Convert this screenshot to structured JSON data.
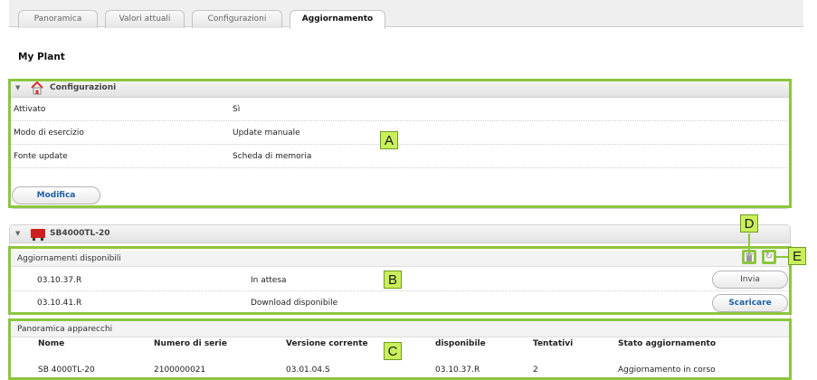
{
  "tabs": [
    {
      "label": "Panoramica",
      "active": false
    },
    {
      "label": "Valori attuali",
      "active": false
    },
    {
      "label": "Configurazioni",
      "active": false
    },
    {
      "label": "Aggiornamento",
      "active": true
    }
  ],
  "plant_title": "My Plant",
  "config_panel": {
    "title": "Configurazioni",
    "rows": [
      {
        "label": "Attivato",
        "value": "Sì"
      },
      {
        "label": "Modo di esercizio",
        "value": "Update manuale"
      },
      {
        "label": "Fonte update",
        "value": "Scheda di memoria"
      }
    ],
    "edit_button": "Modifica"
  },
  "device_panel": {
    "title": "SB4000TL-20",
    "updates_header": "Aggiornamenti disponibili",
    "updates": [
      {
        "version": "03.10.37.R",
        "status": "In attesa",
        "action": "Invia"
      },
      {
        "version": "03.10.41.R",
        "status": "Download disponibile",
        "action": "Scaricare"
      }
    ],
    "overview_header": "Panoramica apparecchi",
    "table": {
      "headers": [
        "Nome",
        "Numero di serie",
        "Versione corrente",
        "disponibile",
        "Tentativi",
        "Stato aggiornamento"
      ],
      "rows": [
        [
          "SB 4000TL-20",
          "2100000021",
          "03.01.04.S",
          "03.10.37.R",
          "2",
          "Aggiornamento in corso"
        ]
      ]
    }
  },
  "annotations": {
    "a": "A",
    "b": "B",
    "c": "C",
    "d": "D",
    "e": "E"
  },
  "icons": {
    "config_icon": "house-icon",
    "device_icon": "inverter-icon",
    "delete_icon": "trash-icon",
    "refresh_icon": "refresh-icon"
  },
  "colors": {
    "annotation_green": "#8cc63f",
    "badge_fill": "#c9f05a",
    "link_blue": "#1d5fa8"
  }
}
